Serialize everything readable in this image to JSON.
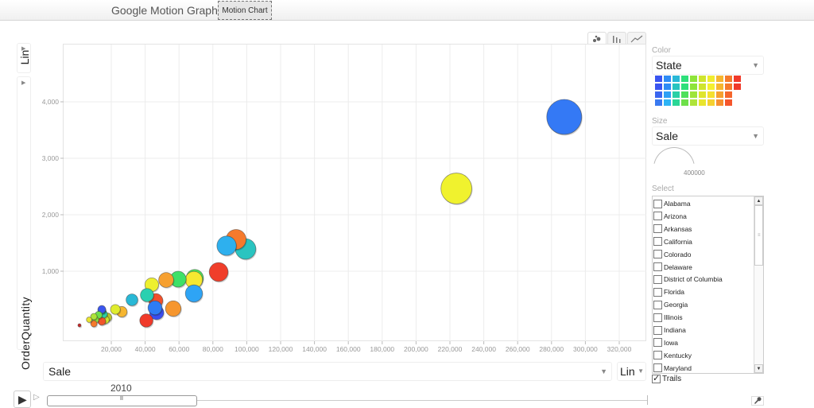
{
  "header": {
    "title": "Google Motion Graph",
    "tab_label": "Motion Chart"
  },
  "chart_types": [
    {
      "name": "bubble",
      "icon": "bubble-chart-icon",
      "glyph": "•:",
      "active": true
    },
    {
      "name": "bar",
      "icon": "bar-chart-icon",
      "glyph": "|||",
      "active": false
    },
    {
      "name": "line",
      "icon": "line-chart-icon",
      "glyph": "∿",
      "active": false
    }
  ],
  "axes": {
    "y_scale": "Lin",
    "y_variable": "OrderQuantity",
    "x_variable": "Sale",
    "x_scale": "Lin",
    "arrow_glyph": "▼",
    "arrow_right_glyph": "▶"
  },
  "sidebar": {
    "color_label": "Color",
    "color_value": "State",
    "size_label": "Size",
    "size_value": "Sale",
    "size_legend_value": "400000",
    "select_label": "Select",
    "trails_label": "Trails",
    "trails_checked": true,
    "swatch_rows": [
      [
        "#3a55f0",
        "#2e8cf5",
        "#29b8d6",
        "#2ee07a",
        "#8ee43a",
        "#cfe52e",
        "#f0ec2e",
        "#f6b630",
        "#f57a2c",
        "#f03a2a"
      ],
      [
        "#3a55f0",
        "#2e8cf5",
        "#29c4c0",
        "#2ee07a",
        "#8ee43a",
        "#cfe52e",
        "#f5f030",
        "#f6b630",
        "#f57a2c",
        "#f03a2a"
      ],
      [
        "#3a66f0",
        "#2ea0f5",
        "#2ad0a6",
        "#4ee05a",
        "#9ee43a",
        "#dfe52e",
        "#f5e030",
        "#f6a030",
        "#f5662c"
      ],
      [
        "#3a7af0",
        "#2eb4f5",
        "#2ad696",
        "#6ee04a",
        "#aee43a",
        "#e9e52e",
        "#f5d030",
        "#f69030",
        "#f5562c"
      ]
    ],
    "states": [
      "Alabama",
      "Arizona",
      "Arkansas",
      "California",
      "Colorado",
      "Delaware",
      "District of Columbia",
      "Florida",
      "Georgia",
      "Illinois",
      "Indiana",
      "Iowa",
      "Kentucky",
      "Maryland"
    ]
  },
  "timeline": {
    "year": "2010",
    "play_glyph": "▶",
    "speed_glyph": "▷",
    "thumb_glyph": "II",
    "wrench_glyph": "🔧"
  },
  "chart_data": {
    "type": "scatter",
    "title": "",
    "xlabel": "Sale",
    "ylabel": "OrderQuantity",
    "xlim": [
      0,
      335000
    ],
    "ylim": [
      0,
      5000
    ],
    "x_ticks": [
      20000,
      40000,
      60000,
      80000,
      100000,
      120000,
      140000,
      160000,
      180000,
      200000,
      220000,
      240000,
      260000,
      280000,
      300000,
      320000
    ],
    "x_tick_labels": [
      "20,000",
      "40,000",
      "60,000",
      "80,000",
      "100,000",
      "120,000",
      "140,000",
      "160,000",
      "180,000",
      "200,000",
      "220,000",
      "240,000",
      "260,000",
      "280,000",
      "300,000",
      "320,000"
    ],
    "y_ticks": [
      1000,
      2000,
      3000,
      4000
    ],
    "y_tick_labels": [
      "1,000",
      "2,000",
      "3,000",
      "4,000"
    ],
    "grid": true,
    "color_by": "State",
    "size_by": "Sale",
    "points": [
      {
        "x": 287500,
        "y": 3732,
        "color": "#3479f5"
      },
      {
        "x": 223800,
        "y": 2465,
        "color": "#f0f22e"
      },
      {
        "x": 93700,
        "y": 1563,
        "color": "#f57a2c"
      },
      {
        "x": 99300,
        "y": 1394,
        "color": "#2ac4c0"
      },
      {
        "x": 88100,
        "y": 1451,
        "color": "#2eb0ee"
      },
      {
        "x": 83400,
        "y": 986,
        "color": "#f03e2a"
      },
      {
        "x": 69300,
        "y": 880,
        "color": "#4ee05a"
      },
      {
        "x": 68800,
        "y": 845,
        "color": "#f5e830"
      },
      {
        "x": 59500,
        "y": 859,
        "color": "#3ee068"
      },
      {
        "x": 52400,
        "y": 845,
        "color": "#f6a030"
      },
      {
        "x": 43900,
        "y": 761,
        "color": "#eef02e"
      },
      {
        "x": 68800,
        "y": 606,
        "color": "#2ea4f5"
      },
      {
        "x": 41100,
        "y": 577,
        "color": "#2ad0b0"
      },
      {
        "x": 46300,
        "y": 479,
        "color": "#f0502a"
      },
      {
        "x": 32200,
        "y": 493,
        "color": "#29b8d6"
      },
      {
        "x": 45800,
        "y": 352,
        "color": "#2e7cf5"
      },
      {
        "x": 46800,
        "y": 268,
        "color": "#3a4ef0"
      },
      {
        "x": 56600,
        "y": 338,
        "color": "#f6962e"
      },
      {
        "x": 40700,
        "y": 127,
        "color": "#f03a2a"
      },
      {
        "x": 22400,
        "y": 324,
        "color": "#dfec2e"
      },
      {
        "x": 26200,
        "y": 282,
        "color": "#f6b630"
      },
      {
        "x": 14400,
        "y": 310,
        "color": "#2ee07a"
      },
      {
        "x": 14400,
        "y": 324,
        "color": "#3a55f0"
      },
      {
        "x": 15300,
        "y": 240,
        "color": "#2ad0a6"
      },
      {
        "x": 12500,
        "y": 225,
        "color": "#6ee04a"
      },
      {
        "x": 9700,
        "y": 197,
        "color": "#aee43a"
      },
      {
        "x": 10600,
        "y": 141,
        "color": "#8ee43a"
      },
      {
        "x": 6900,
        "y": 141,
        "color": "#e9e52e"
      },
      {
        "x": 9700,
        "y": 70,
        "color": "#f57a2c"
      },
      {
        "x": 14400,
        "y": 113,
        "color": "#f0562a"
      },
      {
        "x": 16300,
        "y": 141,
        "color": "#cfe52e"
      },
      {
        "x": 17700,
        "y": 183,
        "color": "#b8c42a"
      },
      {
        "x": 1200,
        "y": 42,
        "color": "#c42a2a"
      }
    ]
  }
}
